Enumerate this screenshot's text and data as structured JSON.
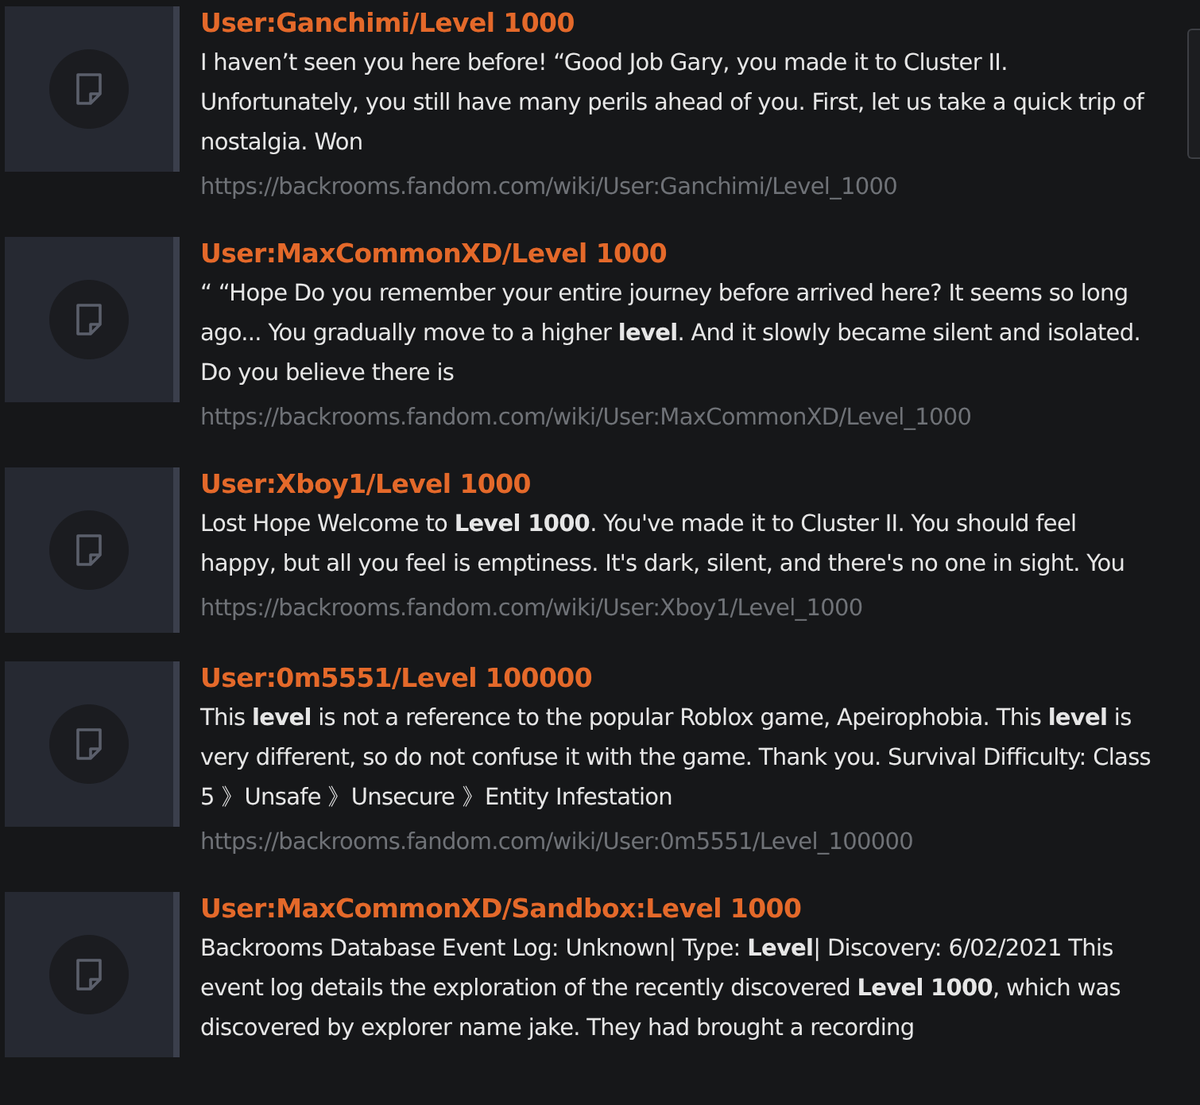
{
  "results": [
    {
      "title": "User:Ganchimi/Level 1000",
      "snippet": "I haven’t seen you here before! “Good Job Gary, you made it to Cluster II. Unfortunately, you still have many perils ahead of you. First, let us take a quick trip of nostalgia. Won",
      "url": "https://backrooms.fandom.com/wiki/User:Ganchimi/Level_1000"
    },
    {
      "title": "User:MaxCommonXD/Level 1000",
      "snippet": "“ “Hope Do you remember your entire journey before arrived here? It seems so long ago... You gradually move to a higher **level**. And it slowly became silent and isolated. Do you believe there is",
      "url": "https://backrooms.fandom.com/wiki/User:MaxCommonXD/Level_1000"
    },
    {
      "title": "User:Xboy1/Level 1000",
      "snippet": "Lost Hope Welcome to **Level 1000**. You've made it to Cluster II. You should feel happy, but all you feel is emptiness. It's dark, silent, and there's no one in sight. You",
      "url": "https://backrooms.fandom.com/wiki/User:Xboy1/Level_1000"
    },
    {
      "title": "User:0m5551/Level 100000",
      "snippet": "This **level** is not a reference to the popular Roblox game, Apeirophobia. This **level** is very different, so do not confuse it with the game. Thank you. Survival Difficulty: Class 5 》Unsafe 》Unsecure 》Entity Infestation",
      "url": "https://backrooms.fandom.com/wiki/User:0m5551/Level_100000"
    },
    {
      "title": "User:MaxCommonXD/Sandbox:Level 1000",
      "snippet": "Backrooms Database Event Log: Unknown| Type: **Level**| Discovery: 6/02/2021 This event log details the exploration of the recently discovered **Level 1000**, which was discovered by explorer name jake. They had brought a recording"
    }
  ]
}
